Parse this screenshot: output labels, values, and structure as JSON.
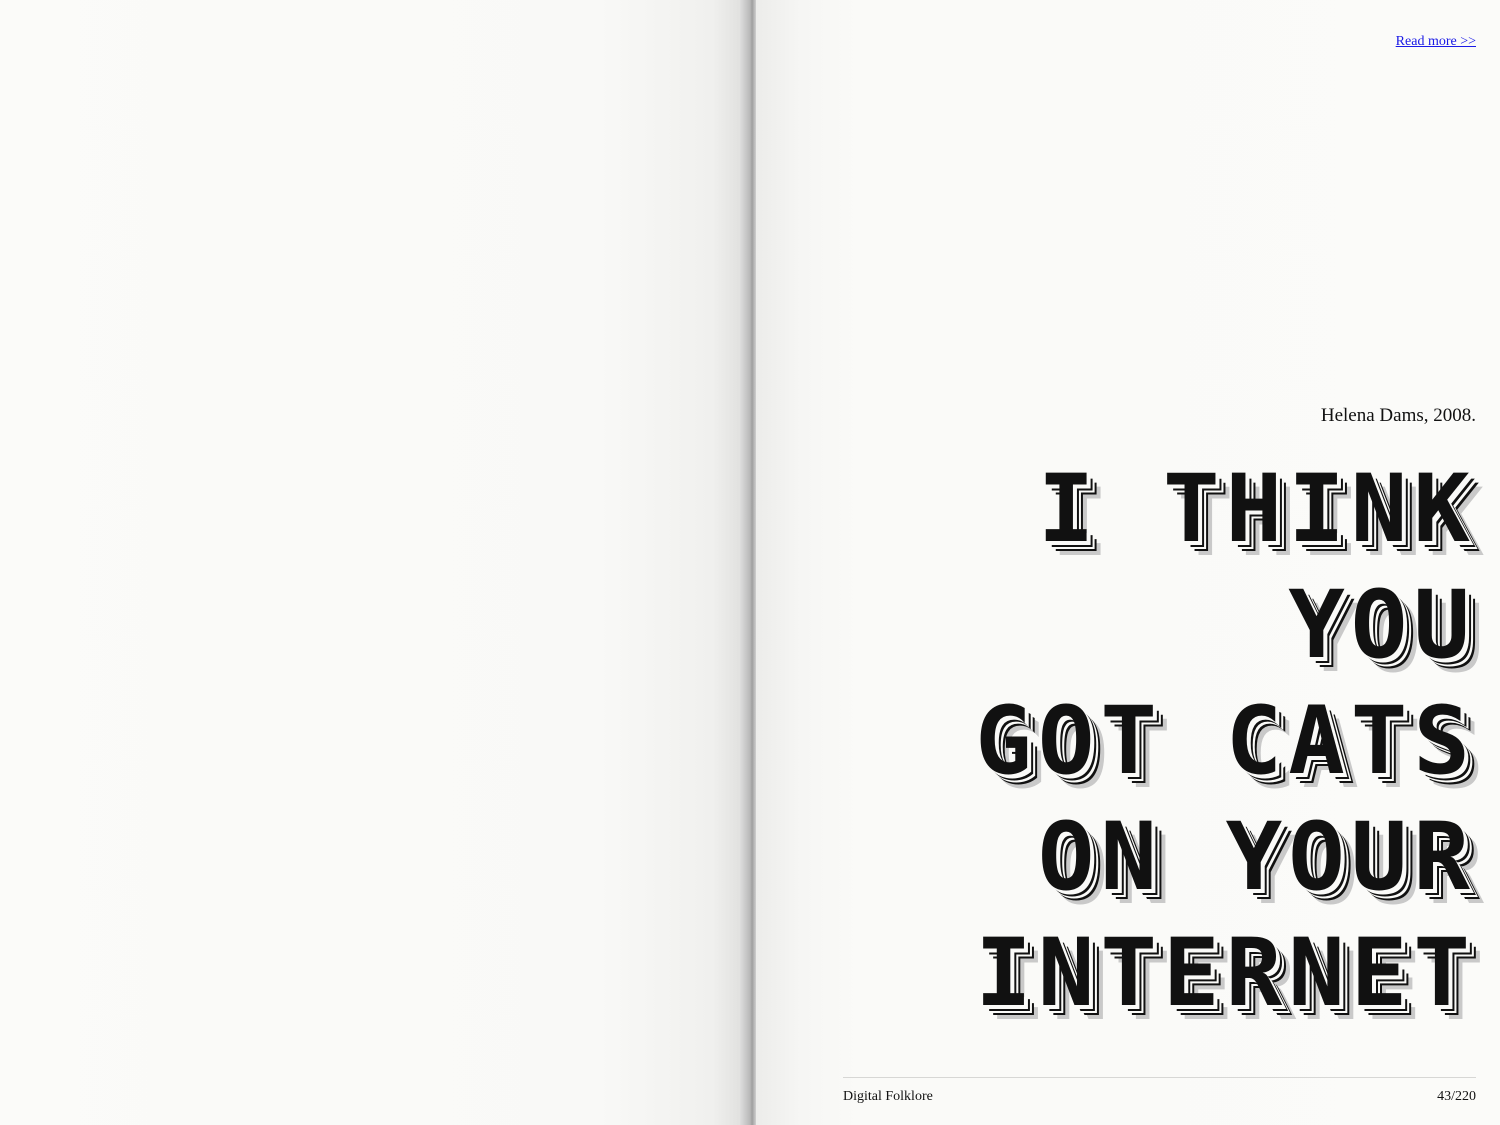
{
  "right_page": {
    "read_more": "Read more >>",
    "credit": "Helena Dams, 2008.",
    "headline_lines": [
      "I THINK",
      "YOU",
      "GOT CATS",
      "ON YOUR",
      "INTERNET"
    ],
    "footer": {
      "book_title": "Digital Folklore",
      "page_number": "43/220"
    }
  }
}
